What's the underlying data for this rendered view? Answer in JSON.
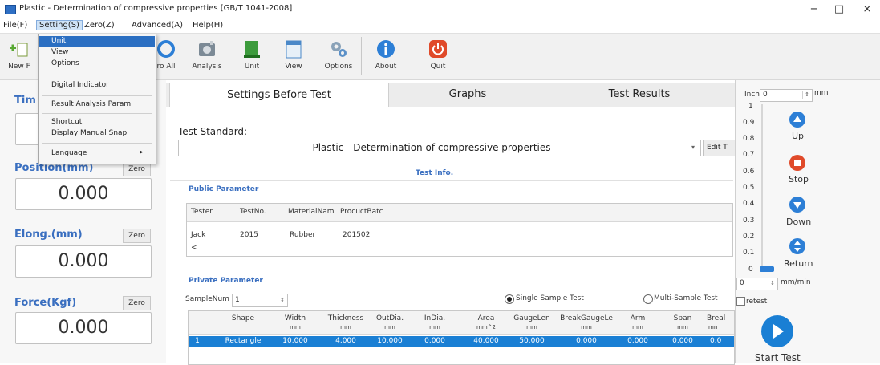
{
  "window": {
    "title": "Plastic - Determination of compressive properties [GB/T 1041-2008]",
    "minimize": "−",
    "maximize": "□",
    "close": "×"
  },
  "menu": [
    "File(F)",
    "Setting(S)",
    "Zero(Z)",
    "Advanced(A)",
    "Help(H)"
  ],
  "setting_menu": {
    "items": [
      "Unit",
      "View",
      "Options",
      "Digital Indicator",
      "Result Analysis Param",
      "Shortcut",
      "Display Manual Snap",
      "Language"
    ],
    "highlighted": "Unit",
    "submenu_arrow": "▸"
  },
  "toolbar": {
    "partial_left": [
      "New F",
      "ro All"
    ],
    "buttons": [
      "Analysis",
      "Unit",
      "View",
      "Options",
      "About",
      "Quit"
    ]
  },
  "left_panel": {
    "time_title": "Tim",
    "position_title": "Position(mm)",
    "position_value": "0.000",
    "elong_title": "Elong.(mm)",
    "elong_value": "0.000",
    "force_title": "Force(Kgf)",
    "force_value": "0.000",
    "zero_label": "Zero"
  },
  "tabs": [
    "Settings Before Test",
    "Graphs",
    "Test Results"
  ],
  "settings": {
    "test_standard_label": "Test Standard:",
    "test_standard_value": "Plastic - Determination of compressive properties",
    "edit_button": "Edit T",
    "test_info": "Test Info.",
    "public_parameter": "Public Parameter",
    "public_headers": [
      "Tester",
      "TestNo.",
      "MaterialNam",
      "ProcuctBatc"
    ],
    "public_values": [
      "Jack",
      "2015",
      "Rubber",
      "201502"
    ],
    "scroll_left": "<",
    "private_parameter": "Private Parameter",
    "samplenum_label": "SampleNum",
    "samplenum_value": "1",
    "single_sample": "Single Sample Test",
    "multi_sample": "Multi-Sample Test",
    "table_headers": [
      {
        "name": "Shape",
        "unit": ""
      },
      {
        "name": "Width",
        "unit": "mm"
      },
      {
        "name": "Thickness",
        "unit": "mm"
      },
      {
        "name": "OutDia.",
        "unit": "mm"
      },
      {
        "name": "InDia.",
        "unit": "mm"
      },
      {
        "name": "Area",
        "unit": "mm^2"
      },
      {
        "name": "GaugeLen",
        "unit": "mm"
      },
      {
        "name": "BreakGaugeLe",
        "unit": "mm"
      },
      {
        "name": "Arm",
        "unit": "mm"
      },
      {
        "name": "Span",
        "unit": "mm"
      },
      {
        "name": "Breal",
        "unit": "mn"
      }
    ],
    "table_row": [
      "1",
      "Rectangle",
      "10.000",
      "4.000",
      "10.000",
      "0.000",
      "40.000",
      "50.000",
      "0.000",
      "0.000",
      "0.000",
      "0.0"
    ]
  },
  "right_panel": {
    "inch_label": "Inch",
    "inch_value": "0",
    "mm_label": "mm",
    "scale": [
      "1",
      "0.9",
      "0.8",
      "0.7",
      "0.6",
      "0.5",
      "0.4",
      "0.3",
      "0.2",
      "0.1",
      "0"
    ],
    "up": "Up",
    "stop": "Stop",
    "down": "Down",
    "return": "Return",
    "speed_value": "0",
    "speed_unit": "mm/min",
    "retest": "retest",
    "start_test": "Start Test"
  },
  "colors": {
    "accent": "#3a6fc0",
    "selection": "#1a7fd4",
    "stop": "#e04a2a"
  }
}
